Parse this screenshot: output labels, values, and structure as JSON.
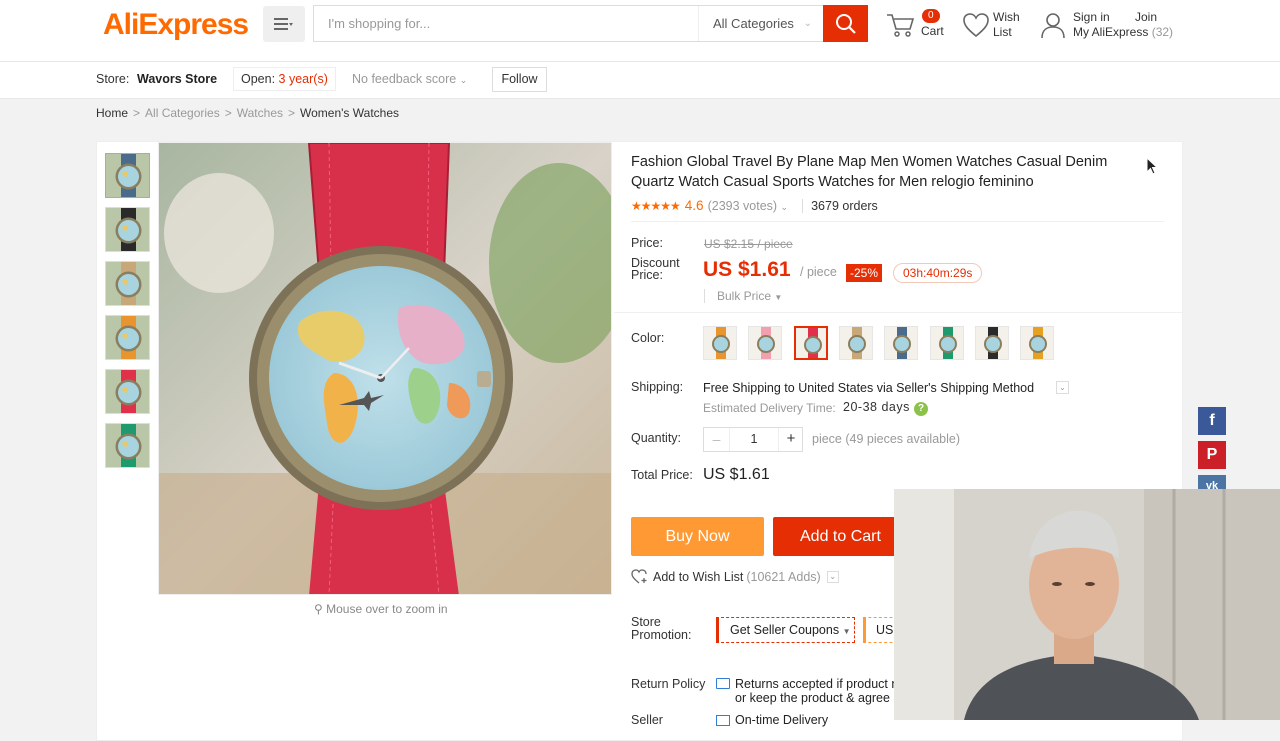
{
  "header": {
    "logo": "AliExpress",
    "search_placeholder": "I'm shopping for...",
    "category_select": "All Categories",
    "cart_count": "0",
    "cart_label": "Cart",
    "wish_label": "Wish List",
    "signin_label": "Sign in",
    "join_label": "Join",
    "my_aliexpress_label": "My AliExpress",
    "my_aliexpress_count": "(32)",
    "accent_color": "#e62e04"
  },
  "store_bar": {
    "store_label": "Store:",
    "store_name": "Wavors Store",
    "open_label": "Open:",
    "open_years": "3 year(s)",
    "feedback": "No feedback score",
    "follow_label": "Follow"
  },
  "breadcrumb": [
    "Home",
    "All Categories",
    "Watches",
    "Women's Watches"
  ],
  "product": {
    "title": "Fashion Global Travel By Plane Map Men Women Watches Casual Denim Quartz Watch Casual Sports Watches for Men relogio feminino",
    "rating_stars": 4.6,
    "rating_value": "4.6",
    "votes": "(2393 votes)",
    "orders": "3679 orders",
    "zoom_hint": "Mouse over to zoom in",
    "price_label": "Price:",
    "original_price": "US $2.15 / piece",
    "discount_label": "Discount Price:",
    "discount_price": "US $1.61",
    "per_piece": "/ piece",
    "discount_percent": "-25%",
    "countdown": "03h:40m:29s",
    "bulk_price": "Bulk Price",
    "color_label": "Color:",
    "colors": [
      "#e8952f",
      "#f2a0b0",
      "#e0304a",
      "#c8a878",
      "#4a6b8a",
      "#1f9a6e",
      "#2a2a2a",
      "#e8a020"
    ],
    "selected_color_index": 2,
    "shipping_label": "Shipping:",
    "shipping_text": "Free Shipping to United States via Seller's Shipping Method",
    "est_delivery_label": "Estimated Delivery Time:",
    "est_delivery_days": "20-38 days",
    "quantity_label": "Quantity:",
    "quantity": "1",
    "quantity_available": "piece (49 pieces available)",
    "total_label": "Total Price:",
    "total_price": "US $1.61",
    "buy_now": "Buy Now",
    "add_to_cart": "Add to Cart",
    "add_wishlist": "Add to Wish List",
    "wishlist_adds": "(10621 Adds)",
    "store_promo_label": "Store Promotion:",
    "seller_coupons": "Get Seller Coupons",
    "coupon2_text": "US",
    "return_label": "Return Policy",
    "return_text_1": "Returns accepted if product n",
    "return_text_2": "or keep the product & agree",
    "seller_label": "Seller",
    "ontime_delivery": "On-time Delivery"
  },
  "thumb_strap_colors": [
    "#4a6b8a",
    "#2a2a2a",
    "#c8a878",
    "#e8952f",
    "#e0304a",
    "#1f9a6e"
  ],
  "social": {
    "facebook": "f",
    "pinterest": "P",
    "vk": "vk"
  }
}
